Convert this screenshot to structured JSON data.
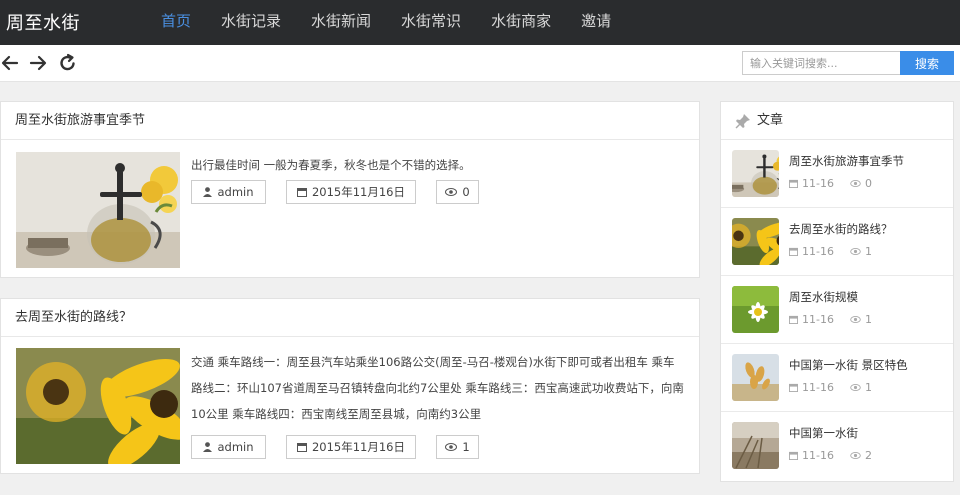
{
  "brand": "周至水街",
  "nav": [
    "首页",
    "水街记录",
    "水街新闻",
    "水街常识",
    "水街商家",
    "邀请"
  ],
  "toolbar": {
    "back_icon": "arrow-left-icon",
    "forward_icon": "arrow-right-icon",
    "refresh_icon": "refresh-icon",
    "search_placeholder": "输入关键词搜索...",
    "search_button": "搜索"
  },
  "articles": [
    {
      "title": "周至水街旅游事宜季节",
      "excerpt": "出行最佳时间 一般为春夏季，秋冬也是个不错的选择。",
      "author": "admin",
      "date": "2015年11月16日",
      "views": "0",
      "thumb": "teapot-photo"
    },
    {
      "title": "去周至水街的路线？",
      "excerpt": "交通 乘车路线一：周至县汽车站乘坐106路公交(周至-马召-楼观台)水街下即可或者出租车 乘车路线二：环山107省道周至马召镇转盘向北约7公里处 乘车路线三：西宝高速武功收费站下，向南10公里 乘车路线四：西宝南线至周至县城，向南约3公里",
      "author": "admin",
      "date": "2015年11月16日",
      "views": "1",
      "thumb": "sunflower-photo"
    }
  ],
  "sidebar": {
    "heading": "文章",
    "heading_icon": "pin-icon",
    "items": [
      {
        "title": "周至水街旅游事宜季节",
        "date": "11-16",
        "views": "0",
        "thumb": "teapot-photo"
      },
      {
        "title": "去周至水街的路线？",
        "date": "11-16",
        "views": "1",
        "thumb": "sunflower-photo"
      },
      {
        "title": "周至水街规模",
        "date": "11-16",
        "views": "1",
        "thumb": "daisy-photo"
      },
      {
        "title": "中国第一水街 景区特色",
        "date": "11-16",
        "views": "1",
        "thumb": "wheat-photo"
      },
      {
        "title": "中国第一水街",
        "date": "11-16",
        "views": "2",
        "thumb": "field-photo"
      }
    ]
  },
  "colors": {
    "nav_bg": "#2a2c2e",
    "accent": "#3a8de8",
    "active_nav": "#4a90e2"
  }
}
